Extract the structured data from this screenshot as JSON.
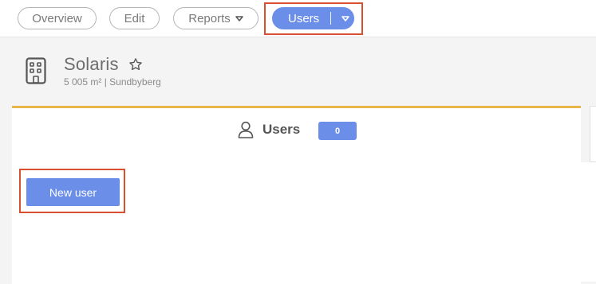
{
  "nav": {
    "overview_label": "Overview",
    "edit_label": "Edit",
    "reports_label": "Reports",
    "users_label": "Users"
  },
  "building": {
    "name": "Solaris",
    "subtitle": "5 005 m² | Sundbyberg",
    "icon": "building-icon"
  },
  "users_section": {
    "title": "Users",
    "count": "0",
    "new_user_label": "New user"
  },
  "colors": {
    "accent": "#6b8ee8",
    "card_top_border": "#e8b64a",
    "highlight": "#d8502f"
  }
}
